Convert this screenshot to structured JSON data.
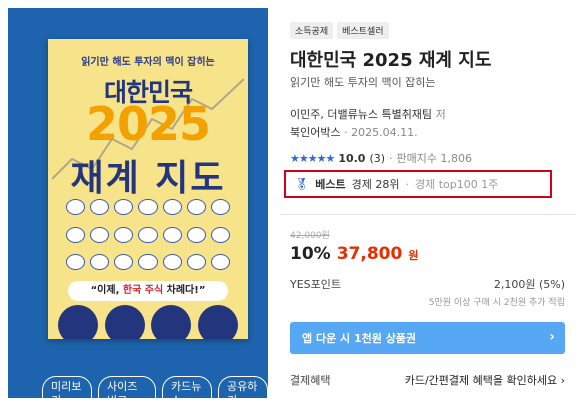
{
  "cover": {
    "tagline": "읽기만 해도 투자의 맥이 잡히는",
    "title_line1": "대한민국",
    "title_year": "2025",
    "title_line2": "재계 지도",
    "slogan_pre": "“이제, ",
    "slogan_highlight": "한국 주식",
    "slogan_post": " 차례다!”"
  },
  "cover_actions": [
    "미리보기",
    "사이즈비교",
    "카드뉴스",
    "공유하기"
  ],
  "product": {
    "tags": [
      "소득공제",
      "베스트셀러"
    ],
    "title": "대한민국 2025 재계 지도",
    "subtitle": "읽기만 해도 투자의 맥이 잡히는",
    "authors": "이민주, 더밸류뉴스 특별취재팀",
    "author_role": "저",
    "publisher": "북인어박스",
    "date": "2025.04.11.",
    "stars": "★★★★★",
    "rating": "10.0",
    "review_count": "(3)",
    "sales_index": "판매지수 1,806",
    "best_label": "베스트",
    "best_rank": "경제 28위",
    "best_top": "경제 top100 1주",
    "original_price": "42,000원",
    "discount": "10%",
    "sale_price": "37,800",
    "currency": "원",
    "points_label": "YES포인트",
    "points_value": "2,100원 (5%)",
    "points_note": "5만원 이상 구매 시 2천원 추가 적립",
    "coupon_label": "앱 다운 시 1천원 상품권",
    "payment_label": "결제혜택",
    "payment_value": "카드/간편결제 혜택을 확인하세요"
  },
  "colors": {
    "accent": "#e62e00",
    "star": "#2d6bd6",
    "highlight_border": "#d0021b",
    "coupon_bg": "#56a8f4",
    "panel_bg": "#1e63ad"
  }
}
